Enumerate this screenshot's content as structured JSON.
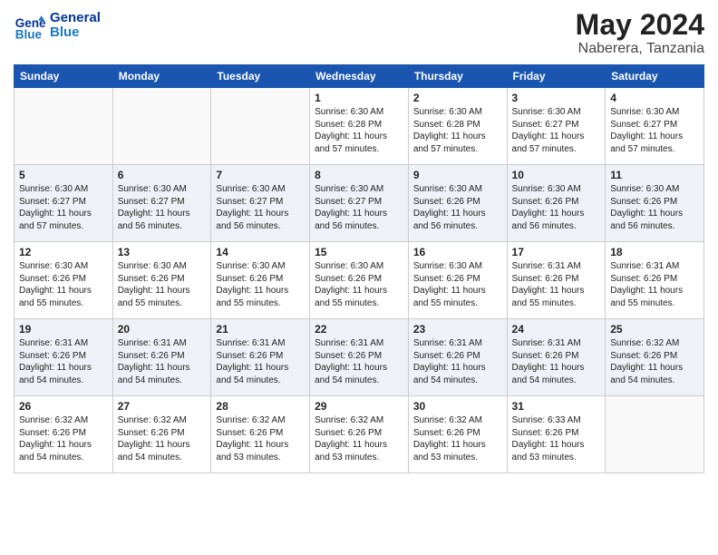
{
  "logo": {
    "text_general": "General",
    "text_blue": "Blue"
  },
  "header": {
    "month_year": "May 2024",
    "location": "Naberera, Tanzania"
  },
  "days_of_week": [
    "Sunday",
    "Monday",
    "Tuesday",
    "Wednesday",
    "Thursday",
    "Friday",
    "Saturday"
  ],
  "weeks": [
    [
      {
        "day": "",
        "info": ""
      },
      {
        "day": "",
        "info": ""
      },
      {
        "day": "",
        "info": ""
      },
      {
        "day": "1",
        "info": "Sunrise: 6:30 AM\nSunset: 6:28 PM\nDaylight: 11 hours\nand 57 minutes."
      },
      {
        "day": "2",
        "info": "Sunrise: 6:30 AM\nSunset: 6:28 PM\nDaylight: 11 hours\nand 57 minutes."
      },
      {
        "day": "3",
        "info": "Sunrise: 6:30 AM\nSunset: 6:27 PM\nDaylight: 11 hours\nand 57 minutes."
      },
      {
        "day": "4",
        "info": "Sunrise: 6:30 AM\nSunset: 6:27 PM\nDaylight: 11 hours\nand 57 minutes."
      }
    ],
    [
      {
        "day": "5",
        "info": "Sunrise: 6:30 AM\nSunset: 6:27 PM\nDaylight: 11 hours\nand 57 minutes."
      },
      {
        "day": "6",
        "info": "Sunrise: 6:30 AM\nSunset: 6:27 PM\nDaylight: 11 hours\nand 56 minutes."
      },
      {
        "day": "7",
        "info": "Sunrise: 6:30 AM\nSunset: 6:27 PM\nDaylight: 11 hours\nand 56 minutes."
      },
      {
        "day": "8",
        "info": "Sunrise: 6:30 AM\nSunset: 6:27 PM\nDaylight: 11 hours\nand 56 minutes."
      },
      {
        "day": "9",
        "info": "Sunrise: 6:30 AM\nSunset: 6:26 PM\nDaylight: 11 hours\nand 56 minutes."
      },
      {
        "day": "10",
        "info": "Sunrise: 6:30 AM\nSunset: 6:26 PM\nDaylight: 11 hours\nand 56 minutes."
      },
      {
        "day": "11",
        "info": "Sunrise: 6:30 AM\nSunset: 6:26 PM\nDaylight: 11 hours\nand 56 minutes."
      }
    ],
    [
      {
        "day": "12",
        "info": "Sunrise: 6:30 AM\nSunset: 6:26 PM\nDaylight: 11 hours\nand 55 minutes."
      },
      {
        "day": "13",
        "info": "Sunrise: 6:30 AM\nSunset: 6:26 PM\nDaylight: 11 hours\nand 55 minutes."
      },
      {
        "day": "14",
        "info": "Sunrise: 6:30 AM\nSunset: 6:26 PM\nDaylight: 11 hours\nand 55 minutes."
      },
      {
        "day": "15",
        "info": "Sunrise: 6:30 AM\nSunset: 6:26 PM\nDaylight: 11 hours\nand 55 minutes."
      },
      {
        "day": "16",
        "info": "Sunrise: 6:30 AM\nSunset: 6:26 PM\nDaylight: 11 hours\nand 55 minutes."
      },
      {
        "day": "17",
        "info": "Sunrise: 6:31 AM\nSunset: 6:26 PM\nDaylight: 11 hours\nand 55 minutes."
      },
      {
        "day": "18",
        "info": "Sunrise: 6:31 AM\nSunset: 6:26 PM\nDaylight: 11 hours\nand 55 minutes."
      }
    ],
    [
      {
        "day": "19",
        "info": "Sunrise: 6:31 AM\nSunset: 6:26 PM\nDaylight: 11 hours\nand 54 minutes."
      },
      {
        "day": "20",
        "info": "Sunrise: 6:31 AM\nSunset: 6:26 PM\nDaylight: 11 hours\nand 54 minutes."
      },
      {
        "day": "21",
        "info": "Sunrise: 6:31 AM\nSunset: 6:26 PM\nDaylight: 11 hours\nand 54 minutes."
      },
      {
        "day": "22",
        "info": "Sunrise: 6:31 AM\nSunset: 6:26 PM\nDaylight: 11 hours\nand 54 minutes."
      },
      {
        "day": "23",
        "info": "Sunrise: 6:31 AM\nSunset: 6:26 PM\nDaylight: 11 hours\nand 54 minutes."
      },
      {
        "day": "24",
        "info": "Sunrise: 6:31 AM\nSunset: 6:26 PM\nDaylight: 11 hours\nand 54 minutes."
      },
      {
        "day": "25",
        "info": "Sunrise: 6:32 AM\nSunset: 6:26 PM\nDaylight: 11 hours\nand 54 minutes."
      }
    ],
    [
      {
        "day": "26",
        "info": "Sunrise: 6:32 AM\nSunset: 6:26 PM\nDaylight: 11 hours\nand 54 minutes."
      },
      {
        "day": "27",
        "info": "Sunrise: 6:32 AM\nSunset: 6:26 PM\nDaylight: 11 hours\nand 54 minutes."
      },
      {
        "day": "28",
        "info": "Sunrise: 6:32 AM\nSunset: 6:26 PM\nDaylight: 11 hours\nand 53 minutes."
      },
      {
        "day": "29",
        "info": "Sunrise: 6:32 AM\nSunset: 6:26 PM\nDaylight: 11 hours\nand 53 minutes."
      },
      {
        "day": "30",
        "info": "Sunrise: 6:32 AM\nSunset: 6:26 PM\nDaylight: 11 hours\nand 53 minutes."
      },
      {
        "day": "31",
        "info": "Sunrise: 6:33 AM\nSunset: 6:26 PM\nDaylight: 11 hours\nand 53 minutes."
      },
      {
        "day": "",
        "info": ""
      }
    ]
  ]
}
